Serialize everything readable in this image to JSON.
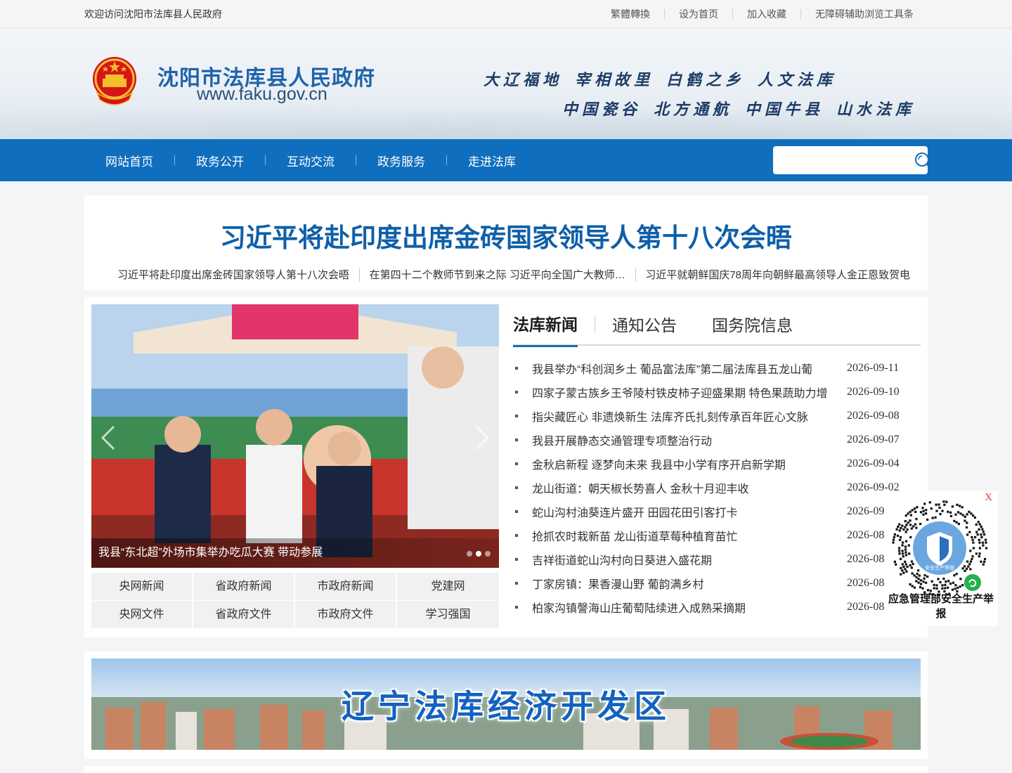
{
  "topbar": {
    "welcome": "欢迎访问沈阳市法库县人民政府",
    "links": [
      "繁體轉換",
      "设为首页",
      "加入收藏",
      "无障碍辅助浏览工具条"
    ]
  },
  "header": {
    "site_name": "沈阳市法库县人民政府",
    "site_url": "www.faku.gov.cn",
    "slogans_line1": [
      "大辽福地",
      "宰相故里",
      "白鹤之乡",
      "人文法库"
    ],
    "slogans_line2": [
      "中国瓷谷",
      "北方通航",
      "中国牛县",
      "山水法库"
    ]
  },
  "nav": {
    "items": [
      "网站首页",
      "政务公开",
      "互动交流",
      "政务服务",
      "走进法库"
    ],
    "search_placeholder": ""
  },
  "headline": {
    "title": "习近平将赴印度出席金砖国家领导人第十八次会晤",
    "subs": [
      "习近平将赴印度出席金砖国家领导人第十八次会晤",
      "在第四十二个教师节到来之际 习近平向全国广大教师…",
      "习近平就朝鲜国庆78周年向朝鲜最高领导人金正恩致贺电"
    ]
  },
  "slider": {
    "caption": "我县“东北超”外场市集举办吃瓜大赛 带动参展",
    "slide_count": 3,
    "active_index": 1
  },
  "quick_links": [
    "央网新闻",
    "省政府新闻",
    "市政府新闻",
    "党建网",
    "央网文件",
    "省政府文件",
    "市政府文件",
    "学习强国"
  ],
  "news": {
    "tabs": [
      "法库新闻",
      "通知公告",
      "国务院信息"
    ],
    "active_tab": 0,
    "items": [
      {
        "title": "我县举办“科创润乡土 葡品富法库”第二届法库县五龙山葡",
        "date": "2026-09-11"
      },
      {
        "title": "四家子蒙古族乡王爷陵村铁皮柿子迎盛果期 特色果蔬助力增",
        "date": "2026-09-10"
      },
      {
        "title": "指尖藏匠心 非遗焕新生 法库齐氏扎刻传承百年匠心文脉",
        "date": "2026-09-08"
      },
      {
        "title": "我县开展静态交通管理专项整治行动",
        "date": "2026-09-07"
      },
      {
        "title": "金秋启新程 逐梦向未来 我县中小学有序开启新学期",
        "date": "2026-09-04"
      },
      {
        "title": "龙山街道：朝天椒长势喜人 金秋十月迎丰收",
        "date": "2026-09-02"
      },
      {
        "title": "蛇山沟村油葵连片盛开 田园花田引客打卡",
        "date": "2026-09-"
      },
      {
        "title": "抢抓农时栽新苗 龙山街道草莓种植育苗忙",
        "date": "2026-08-"
      },
      {
        "title": "吉祥街道蛇山沟村向日葵进入盛花期",
        "date": "2026-08-"
      },
      {
        "title": "丁家房镇：果香漫山野 葡韵满乡村",
        "date": "2026-08-"
      },
      {
        "title": "柏家沟镇謦海山庄葡萄陆续进入成熟采摘期",
        "date": "2026-08-"
      }
    ]
  },
  "float_qr": {
    "close": "X",
    "label": "应急管理部安全生产举报",
    "badge_text": "安全生产举报"
  },
  "banner": {
    "text": "辽宁法库经济开发区"
  },
  "colors": {
    "nav_blue": "#0f6ebd",
    "headline_blue": "#0f5fa8",
    "banner_blue": "#1462c0"
  }
}
